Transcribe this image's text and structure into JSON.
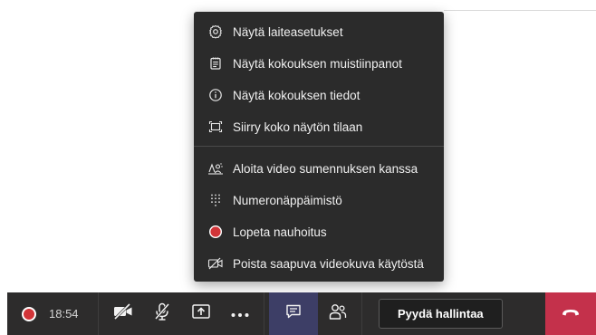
{
  "menu": {
    "items": [
      {
        "label": "Näytä laiteasetukset",
        "icon": "gear-icon"
      },
      {
        "label": "Näytä kokouksen muistiinpanot",
        "icon": "notes-icon"
      },
      {
        "label": "Näytä kokouksen tiedot",
        "icon": "info-icon"
      },
      {
        "label": "Siirry koko näytön tilaan",
        "icon": "fullscreen-icon"
      },
      {
        "label": "Aloita video sumennuksen kanssa",
        "icon": "blur-background-icon"
      },
      {
        "label": "Numeronäppäimistö",
        "icon": "dialpad-icon"
      },
      {
        "label": "Lopeta nauhoitus",
        "icon": "stop-recording-icon"
      },
      {
        "label": "Poista saapuva videokuva käytöstä",
        "icon": "incoming-video-off-icon"
      }
    ]
  },
  "call_bar": {
    "timer": "18:54",
    "request_control_label": "Pyydä hallintaa"
  },
  "colors": {
    "menu_bg": "#2b2b2b",
    "bar_bg": "#2d2c2c",
    "recording_red": "#d13438",
    "hangup_red": "#c4314b",
    "active_highlight": "#3d3e66"
  }
}
